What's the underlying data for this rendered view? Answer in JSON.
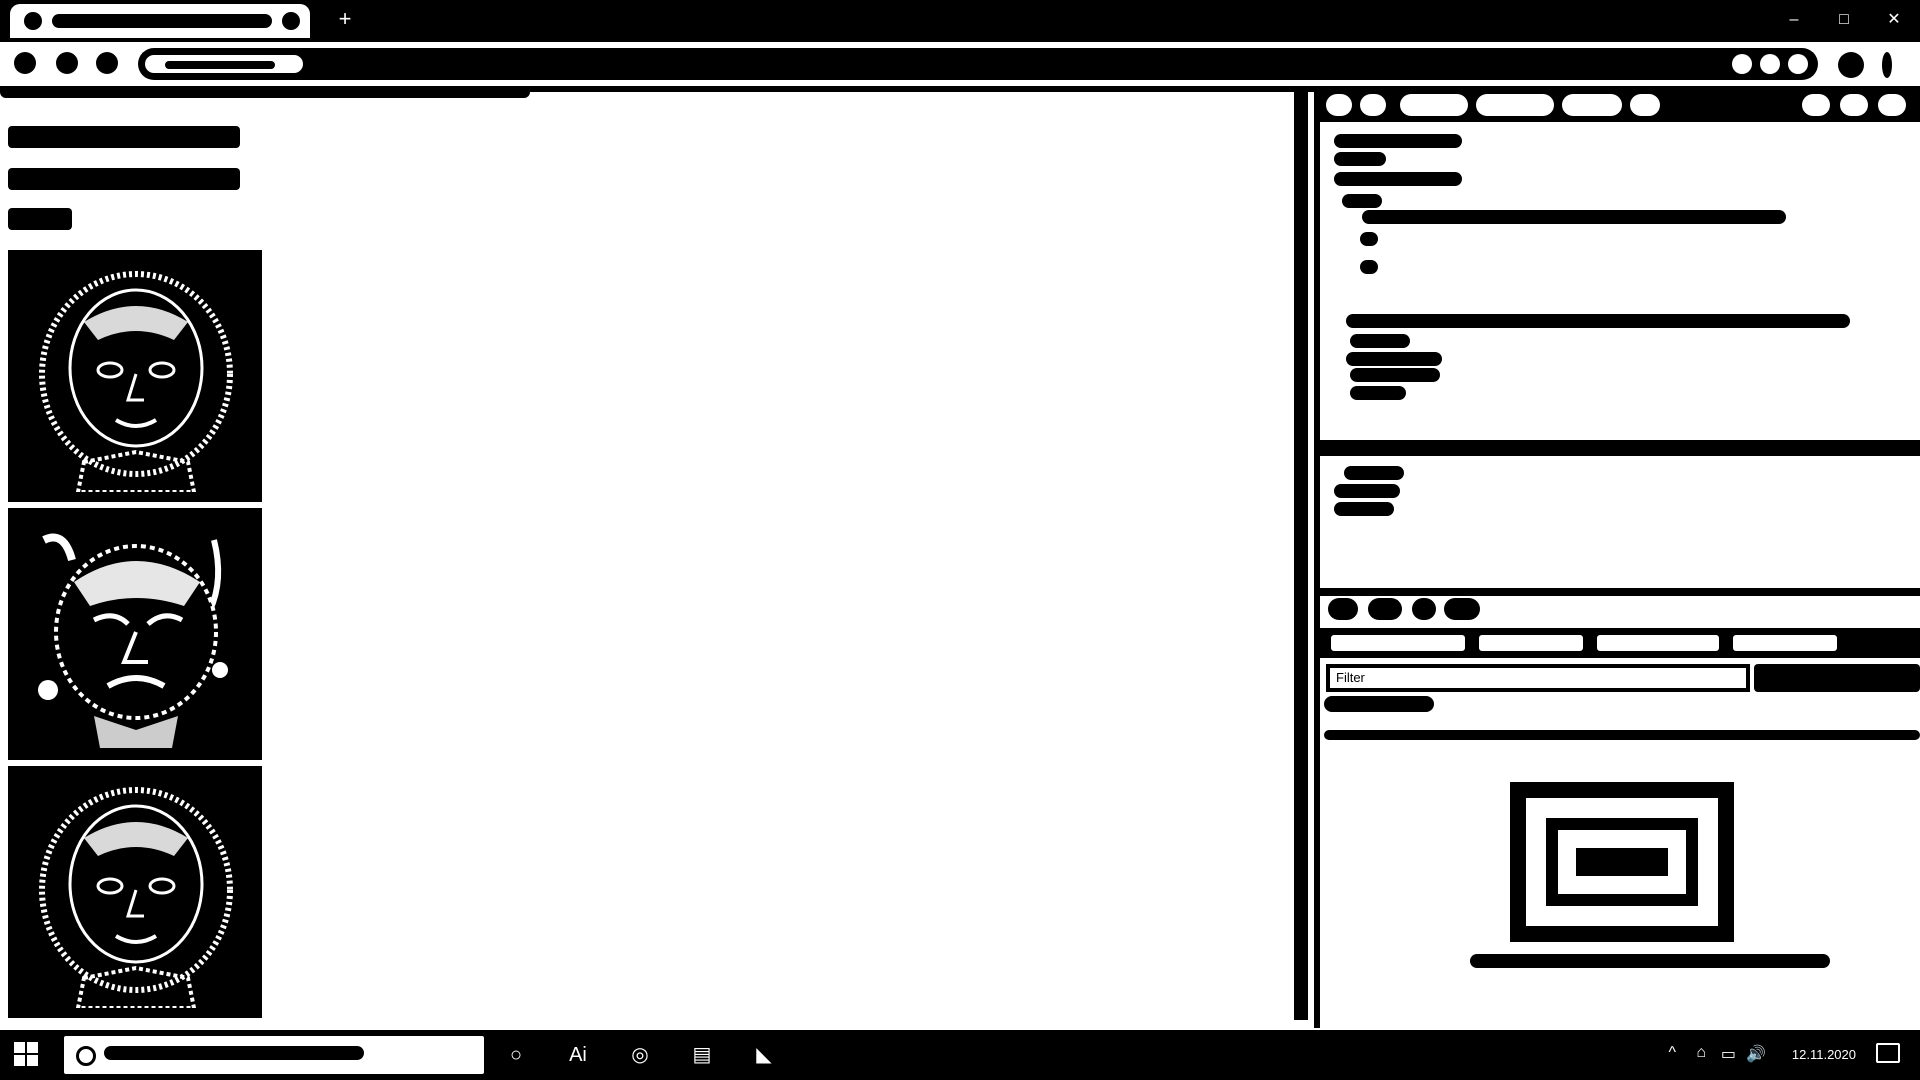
{
  "browser": {
    "active_tab_title": "",
    "new_tab_symbol": "+",
    "window_controls": {
      "minimize": "–",
      "maximize": "□",
      "close": "✕"
    },
    "address": ""
  },
  "app": {
    "images": [
      {
        "kind": "portrait",
        "variant": "normal"
      },
      {
        "kind": "portrait",
        "variant": "distorted"
      },
      {
        "kind": "portrait",
        "variant": "normal"
      }
    ]
  },
  "devtools": {
    "filter_placeholder": "Filter",
    "tabs": [
      "",
      "",
      "",
      "",
      ""
    ]
  },
  "taskbar": {
    "clock": "12.11.2020",
    "icons": [
      "task-view-icon",
      "text-icon",
      "chrome-icon",
      "store-icon",
      "vs-icon"
    ],
    "tray_up_arrow": "^",
    "tray_network": "⌂",
    "tray_volume": "🔊"
  },
  "colors": {
    "foreground": "#000000",
    "background": "#ffffff"
  }
}
